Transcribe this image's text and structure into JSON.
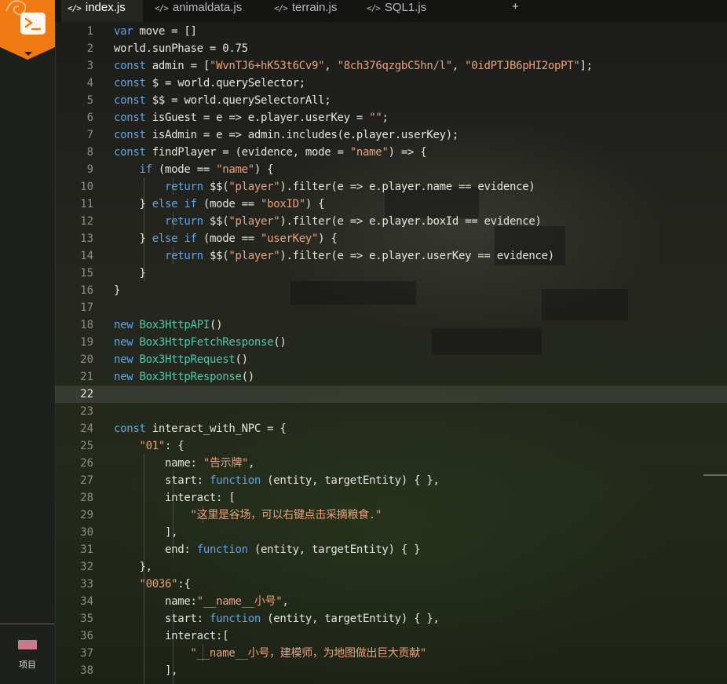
{
  "sidebar": {
    "logo_icon": "terminal-icon",
    "project_label": "项目"
  },
  "tabs": [
    {
      "label": "index.js",
      "icon": "</>",
      "active": true
    },
    {
      "label": "animaldata.js",
      "icon": "</>",
      "active": false
    },
    {
      "label": "terrain.js",
      "icon": "</>",
      "active": false
    },
    {
      "label": "SQL1.js",
      "icon": "</>",
      "active": false
    }
  ],
  "add_tab_label": "+",
  "editor": {
    "current_line": 22,
    "lines": [
      {
        "n": "1",
        "t": [
          [
            "kw",
            "var"
          ],
          [
            "",
            "move = []"
          ]
        ]
      },
      {
        "n": "2",
        "t": [
          [
            "",
            "world.sunPhase = 0.75"
          ]
        ]
      },
      {
        "n": "3",
        "t": [
          [
            "kw",
            "const"
          ],
          [
            "",
            "admin = ["
          ],
          [
            "str",
            "\"WvnTJ6+hK53t6Cv9\""
          ],
          [
            "",
            ", "
          ],
          [
            "str",
            "\"8ch376qzgbC5hn/l\""
          ],
          [
            "",
            ", "
          ],
          [
            "str",
            "\"0idPTJB6pHI2opPT\""
          ],
          [
            "",
            "];"
          ]
        ]
      },
      {
        "n": "4",
        "t": [
          [
            "kw",
            "const"
          ],
          [
            "",
            "$ = world.querySelector;"
          ]
        ]
      },
      {
        "n": "5",
        "t": [
          [
            "kw",
            "const"
          ],
          [
            "",
            "$$ = world.querySelectorAll;"
          ]
        ]
      },
      {
        "n": "6",
        "t": [
          [
            "kw",
            "const"
          ],
          [
            "",
            "isGuest = e => e.player.userKey = "
          ],
          [
            "str",
            "\"\""
          ],
          [
            "",
            ";"
          ]
        ]
      },
      {
        "n": "7",
        "t": [
          [
            "kw",
            "const"
          ],
          [
            "",
            "isAdmin = e => admin.includes(e.player.userKey);"
          ]
        ]
      },
      {
        "n": "8",
        "t": [
          [
            "kw",
            "const"
          ],
          [
            "",
            "findPlayer = (evidence, mode = "
          ],
          [
            "str",
            "\"name\""
          ],
          [
            "",
            ") => {"
          ]
        ]
      },
      {
        "n": "9",
        "t": [
          [
            "",
            "    "
          ],
          [
            "kw",
            "if"
          ],
          [
            "",
            "(mode == "
          ],
          [
            "str",
            "\"name\""
          ],
          [
            "",
            ") {"
          ]
        ]
      },
      {
        "n": "10",
        "t": [
          [
            "",
            "        "
          ],
          [
            "kw",
            "return"
          ],
          [
            "",
            "$$("
          ],
          [
            "str",
            "\"player\""
          ],
          [
            "",
            ").filter(e => e.player.name == evidence)"
          ]
        ]
      },
      {
        "n": "11",
        "t": [
          [
            "",
            "    } "
          ],
          [
            "kw",
            "else if"
          ],
          [
            "",
            "(mode == "
          ],
          [
            "str",
            "\"boxID\""
          ],
          [
            "",
            ") {"
          ]
        ]
      },
      {
        "n": "12",
        "t": [
          [
            "",
            "        "
          ],
          [
            "kw",
            "return"
          ],
          [
            "",
            "$$("
          ],
          [
            "str",
            "\"player\""
          ],
          [
            "",
            ").filter(e => e.player.boxId == evidence)"
          ]
        ]
      },
      {
        "n": "13",
        "t": [
          [
            "",
            "    } "
          ],
          [
            "kw",
            "else if"
          ],
          [
            "",
            "(mode == "
          ],
          [
            "str",
            "\"userKey\""
          ],
          [
            "",
            ") {"
          ]
        ]
      },
      {
        "n": "14",
        "t": [
          [
            "",
            "        "
          ],
          [
            "kw",
            "return"
          ],
          [
            "",
            "$$("
          ],
          [
            "str",
            "\"player\""
          ],
          [
            "",
            ").filter(e => e.player.userKey == evidence)"
          ]
        ]
      },
      {
        "n": "15",
        "t": [
          [
            "",
            "    }"
          ]
        ]
      },
      {
        "n": "16",
        "t": [
          [
            "",
            "}"
          ]
        ]
      },
      {
        "n": "17",
        "t": []
      },
      {
        "n": "18",
        "t": [
          [
            "kw",
            "new"
          ],
          [
            "cls",
            "Box3HttpAPI"
          ],
          [
            "",
            "()"
          ]
        ]
      },
      {
        "n": "19",
        "t": [
          [
            "kw",
            "new"
          ],
          [
            "cls",
            "Box3HttpFetchResponse"
          ],
          [
            "",
            "()"
          ]
        ]
      },
      {
        "n": "20",
        "t": [
          [
            "kw",
            "new"
          ],
          [
            "cls",
            "Box3HttpRequest"
          ],
          [
            "",
            "()"
          ]
        ]
      },
      {
        "n": "21",
        "t": [
          [
            "kw",
            "new"
          ],
          [
            "cls",
            "Box3HttpResponse"
          ],
          [
            "",
            "()"
          ]
        ]
      },
      {
        "n": "22",
        "t": []
      },
      {
        "n": "23",
        "t": []
      },
      {
        "n": "24",
        "t": [
          [
            "kw",
            "const"
          ],
          [
            "",
            "interact_with_NPC = {"
          ]
        ]
      },
      {
        "n": "25",
        "t": [
          [
            "",
            "    "
          ],
          [
            "str",
            "\"01\""
          ],
          [
            "",
            ": {"
          ]
        ]
      },
      {
        "n": "26",
        "t": [
          [
            "",
            "        name: "
          ],
          [
            "str",
            "\"告示牌\""
          ],
          [
            "",
            ","
          ]
        ]
      },
      {
        "n": "27",
        "t": [
          [
            "",
            "        start: "
          ],
          [
            "kw",
            "function"
          ],
          [
            "",
            "(entity, targetEntity) { },"
          ]
        ]
      },
      {
        "n": "28",
        "t": [
          [
            "",
            "        interact: ["
          ]
        ]
      },
      {
        "n": "29",
        "t": [
          [
            "",
            "            "
          ],
          [
            "str",
            "\"这里是谷场，可以右键点击采摘粮食.\""
          ]
        ]
      },
      {
        "n": "30",
        "t": [
          [
            "",
            "        ],"
          ]
        ]
      },
      {
        "n": "31",
        "t": [
          [
            "",
            "        end: "
          ],
          [
            "kw",
            "function"
          ],
          [
            "",
            "(entity, targetEntity) { }"
          ]
        ]
      },
      {
        "n": "32",
        "t": [
          [
            "",
            "    },"
          ]
        ]
      },
      {
        "n": "33",
        "t": [
          [
            "",
            "    "
          ],
          [
            "str",
            "\"0036\""
          ],
          [
            "",
            ":{"
          ]
        ]
      },
      {
        "n": "34",
        "t": [
          [
            "",
            "        name:"
          ],
          [
            "str",
            "\"__name__小号\""
          ],
          [
            "",
            ","
          ]
        ]
      },
      {
        "n": "35",
        "t": [
          [
            "",
            "        start: "
          ],
          [
            "kw",
            "function"
          ],
          [
            "",
            "(entity, targetEntity) { },"
          ]
        ]
      },
      {
        "n": "36",
        "t": [
          [
            "",
            "        interact:["
          ]
        ]
      },
      {
        "n": "37",
        "t": [
          [
            "",
            "            "
          ],
          [
            "str",
            "\"__name__小号，建模师，为地图做出巨大贡献\""
          ]
        ]
      },
      {
        "n": "38",
        "t": [
          [
            "",
            "        ],"
          ]
        ]
      }
    ]
  }
}
